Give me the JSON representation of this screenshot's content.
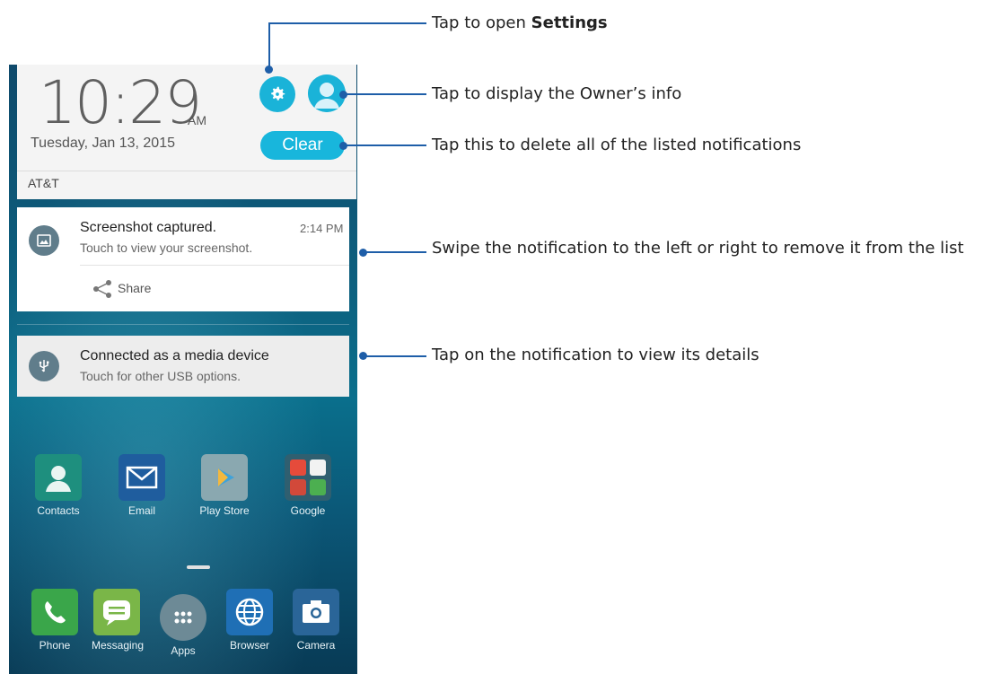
{
  "status": {
    "time": "10:29",
    "ampm": "AM",
    "date": "Tuesday, Jan 13, 2015",
    "carrier": "AT&T"
  },
  "quick_settings": {
    "clear_label": "Clear"
  },
  "notifications": [
    {
      "title": "Screenshot captured.",
      "subtitle": "Touch to view your screenshot.",
      "time": "2:14 PM",
      "action": "Share",
      "icon": "image-icon"
    },
    {
      "title": "Connected as a media device",
      "subtitle": "Touch for other USB options.",
      "icon": "usb-icon"
    }
  ],
  "home_apps": [
    {
      "label": "Contacts",
      "icon": "contacts-icon",
      "color": "#1e8f7e"
    },
    {
      "label": "Email",
      "icon": "email-icon",
      "color": "#1f5d9e"
    },
    {
      "label": "Play Store",
      "icon": "play-store-icon",
      "color": "#8aa8b0"
    },
    {
      "label": "Google",
      "icon": "google-folder-icon",
      "color": "#2f5f70"
    }
  ],
  "dock_apps": [
    {
      "label": "Phone",
      "icon": "phone-icon",
      "color": "#3aa64a"
    },
    {
      "label": "Messaging",
      "icon": "messaging-icon",
      "color": "#7ab648"
    },
    {
      "label": "Apps",
      "icon": "apps-icon",
      "color": "#6d8a96"
    },
    {
      "label": "Browser",
      "icon": "browser-icon",
      "color": "#1f6fb5"
    },
    {
      "label": "Camera",
      "icon": "camera-icon",
      "color": "#2a6598"
    }
  ],
  "callouts": {
    "settings_prefix": "Tap to open ",
    "settings_bold": "Settings",
    "owner": "Tap to display the Owner’s info",
    "clear": "Tap this to delete all of the listed notifications",
    "swipe": "Swipe the notification to the left or right to remove it from the list",
    "details": "Tap on the notification to view its details"
  },
  "colors": {
    "accent": "#1ab3d8",
    "callout_line": "#1e5ea8"
  }
}
